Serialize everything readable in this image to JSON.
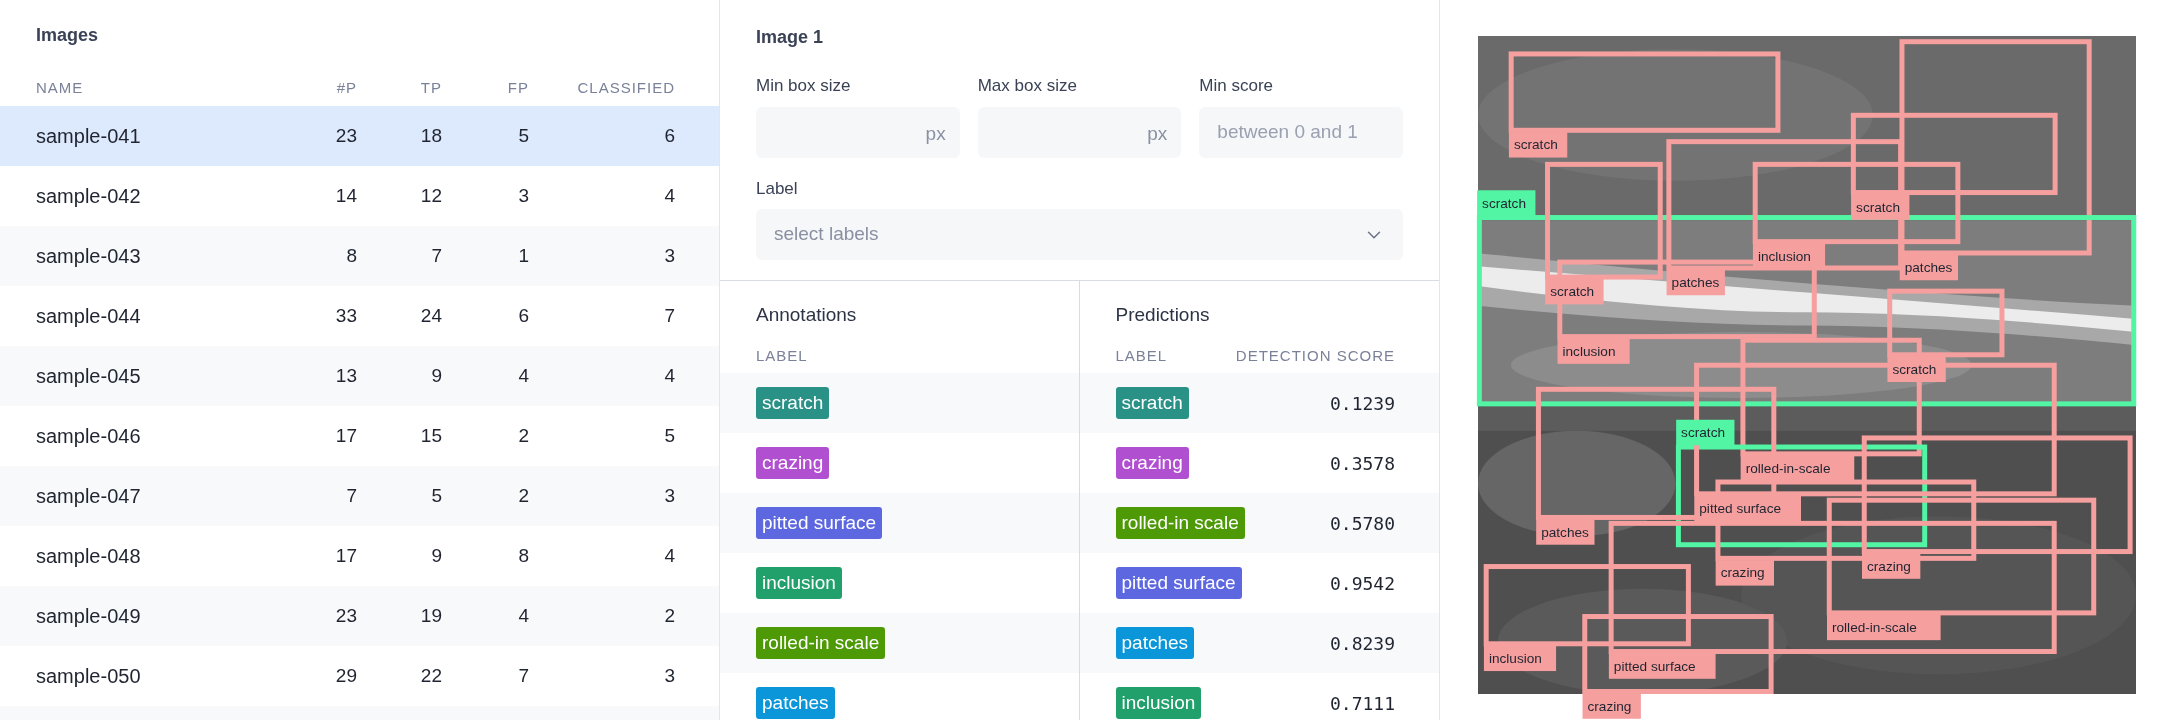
{
  "images": {
    "title": "Images",
    "columns": [
      "NAME",
      "#P",
      "TP",
      "FP",
      "CLASSIFIED"
    ],
    "rows": [
      {
        "name": "sample-041",
        "p": "23",
        "tp": "18",
        "fp": "5",
        "classified": "6",
        "selected": true
      },
      {
        "name": "sample-042",
        "p": "14",
        "tp": "12",
        "fp": "3",
        "classified": "4",
        "selected": false
      },
      {
        "name": "sample-043",
        "p": "8",
        "tp": "7",
        "fp": "1",
        "classified": "3",
        "selected": false
      },
      {
        "name": "sample-044",
        "p": "33",
        "tp": "24",
        "fp": "6",
        "classified": "7",
        "selected": false
      },
      {
        "name": "sample-045",
        "p": "13",
        "tp": "9",
        "fp": "4",
        "classified": "4",
        "selected": false
      },
      {
        "name": "sample-046",
        "p": "17",
        "tp": "15",
        "fp": "2",
        "classified": "5",
        "selected": false
      },
      {
        "name": "sample-047",
        "p": "7",
        "tp": "5",
        "fp": "2",
        "classified": "3",
        "selected": false
      },
      {
        "name": "sample-048",
        "p": "17",
        "tp": "9",
        "fp": "8",
        "classified": "4",
        "selected": false
      },
      {
        "name": "sample-049",
        "p": "23",
        "tp": "19",
        "fp": "4",
        "classified": "2",
        "selected": false
      },
      {
        "name": "sample-050",
        "p": "29",
        "tp": "22",
        "fp": "7",
        "classified": "3",
        "selected": false
      }
    ]
  },
  "detail": {
    "title": "Image 1",
    "fields": [
      {
        "label": "Min box size",
        "unit": "px"
      },
      {
        "label": "Max box size",
        "unit": "px"
      },
      {
        "label": "Min score",
        "placeholder": "between 0 and 1"
      }
    ],
    "label_select": {
      "label": "Label",
      "placeholder": "select labels"
    },
    "annotations": {
      "title": "Annotations",
      "columns": [
        "LABEL"
      ],
      "rows": [
        {
          "label": "scratch",
          "color": "#2a9187"
        },
        {
          "label": "crazing",
          "color": "#b04fd0"
        },
        {
          "label": "pitted surface",
          "color": "#5d67e0"
        },
        {
          "label": "inclusion",
          "color": "#22a06b"
        },
        {
          "label": "rolled-in scale",
          "color": "#4e9a06"
        },
        {
          "label": "patches",
          "color": "#0a96d8"
        }
      ]
    },
    "predictions": {
      "title": "Predictions",
      "columns": [
        "LABEL",
        "DETECTION SCORE"
      ],
      "rows": [
        {
          "label": "scratch",
          "color": "#2a9187",
          "score": "0.1239"
        },
        {
          "label": "crazing",
          "color": "#b04fd0",
          "score": "0.3578"
        },
        {
          "label": "rolled-in scale",
          "color": "#4e9a06",
          "score": "0.5780"
        },
        {
          "label": "pitted surface",
          "color": "#5d67e0",
          "score": "0.9542"
        },
        {
          "label": "patches",
          "color": "#0a96d8",
          "score": "0.8239"
        },
        {
          "label": "inclusion",
          "color": "#22a06b",
          "score": "0.7111"
        }
      ]
    }
  },
  "viewer": {
    "boxes": [
      {
        "label": "scratch",
        "kind": "prediction"
      },
      {
        "label": "patches",
        "kind": "prediction"
      },
      {
        "label": "scratch",
        "kind": "prediction"
      },
      {
        "label": "scratch",
        "kind": "annotation"
      },
      {
        "label": "scratch",
        "kind": "prediction"
      },
      {
        "label": "patches",
        "kind": "prediction"
      },
      {
        "label": "inclusion",
        "kind": "prediction"
      },
      {
        "label": "inclusion",
        "kind": "prediction"
      },
      {
        "label": "scratch",
        "kind": "prediction"
      },
      {
        "label": "rolled-in-scale",
        "kind": "prediction"
      },
      {
        "label": "scratch",
        "kind": "annotation"
      },
      {
        "label": "pitted surface",
        "kind": "prediction"
      },
      {
        "label": "patches",
        "kind": "prediction"
      },
      {
        "label": "crazing",
        "kind": "prediction"
      },
      {
        "label": "crazing",
        "kind": "prediction"
      },
      {
        "label": "rolled-in-scale",
        "kind": "prediction"
      },
      {
        "label": "pitted surface",
        "kind": "prediction"
      },
      {
        "label": "inclusion",
        "kind": "prediction"
      },
      {
        "label": "crazing",
        "kind": "prediction"
      }
    ]
  }
}
